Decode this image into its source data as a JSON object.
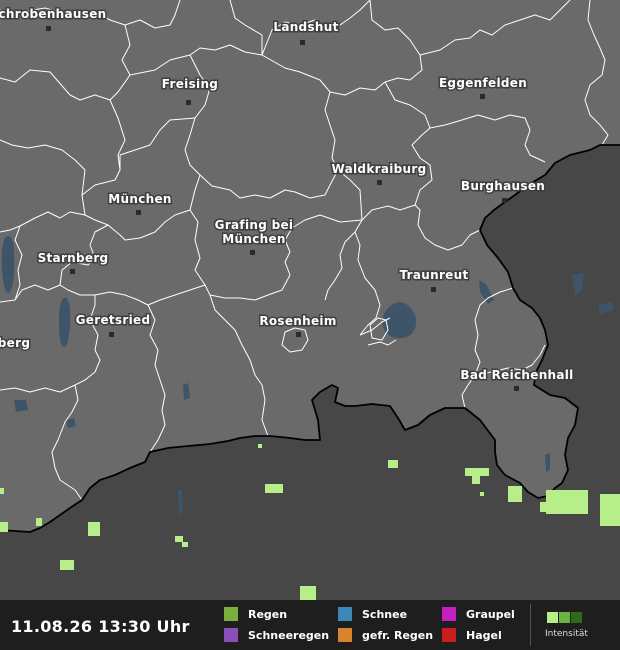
{
  "map": {
    "cities": [
      {
        "id": "schrobenhausen",
        "name": "Schrobenhausen"
      },
      {
        "id": "landshut",
        "name": "Landshut"
      },
      {
        "id": "freising",
        "name": "Freising"
      },
      {
        "id": "eggenfelden",
        "name": "Eggenfelden"
      },
      {
        "id": "waldkraiburg",
        "name": "Waldkraiburg"
      },
      {
        "id": "burghausen",
        "name": "Burghausen"
      },
      {
        "id": "muenchen",
        "name": "München"
      },
      {
        "id": "grafing",
        "name": "Grafing bei"
      },
      {
        "id": "grafing-2",
        "name": "München"
      },
      {
        "id": "starnberg",
        "name": "Starnberg"
      },
      {
        "id": "traunreut",
        "name": "Traunreut"
      },
      {
        "id": "geretsried",
        "name": "Geretsried"
      },
      {
        "id": "rosenheim",
        "name": "Rosenheim"
      },
      {
        "id": "bad-reichenhall",
        "name": "Bad Reichenhall"
      },
      {
        "id": "weilheim-partial",
        "name": "berg"
      }
    ],
    "colors": {
      "land": "#6a6a6a",
      "outside": "#474747",
      "water": "#3e5468",
      "rain": "#b8ee8a",
      "border": "#ffffff",
      "national_border": "#000000"
    }
  },
  "legend": {
    "timestamp": "11.08.26 13:30 Uhr",
    "items": [
      {
        "label": "Regen",
        "color": "#7cae3c"
      },
      {
        "label": "Schneeregen",
        "color": "#8a4fb8"
      },
      {
        "label": "Schnee",
        "color": "#3d87b8"
      },
      {
        "label": "gefr. Regen",
        "color": "#d9842c"
      },
      {
        "label": "Graupel",
        "color": "#c61fbf"
      },
      {
        "label": "Hagel",
        "color": "#c81e1e"
      }
    ],
    "intensity_label": "Intensität",
    "intensity_colors": [
      "#b8ee8a",
      "#6db33f",
      "#2e6b17"
    ]
  }
}
